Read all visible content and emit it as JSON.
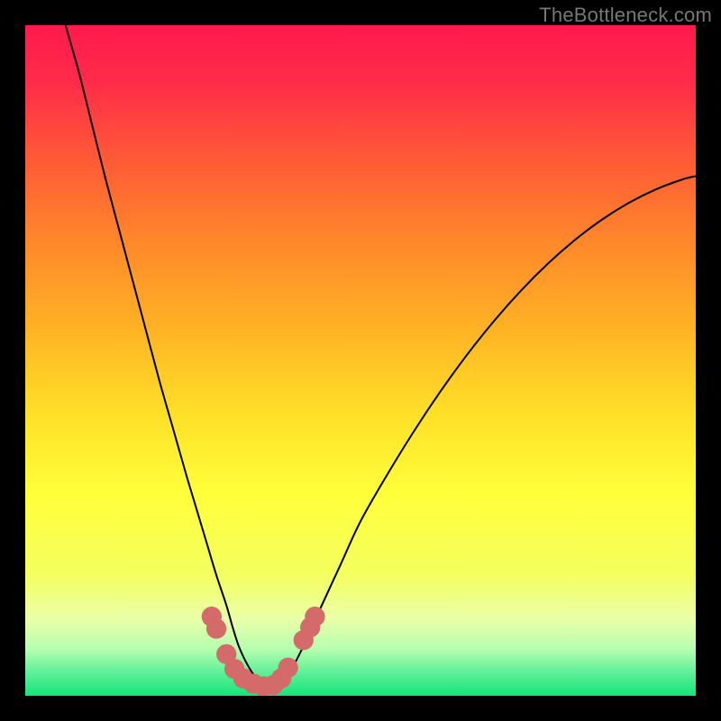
{
  "watermark": "TheBottleneck.com",
  "chart_data": {
    "type": "line",
    "title": "",
    "xlabel": "",
    "ylabel": "",
    "xlim": [
      0,
      100
    ],
    "ylim": [
      0,
      100
    ],
    "grid": false,
    "legend": false,
    "gradient_stops": [
      {
        "pos": 0.0,
        "color": "#ff1a4d"
      },
      {
        "pos": 0.08,
        "color": "#ff2a4a"
      },
      {
        "pos": 0.2,
        "color": "#ff5a36"
      },
      {
        "pos": 0.33,
        "color": "#ff8a2a"
      },
      {
        "pos": 0.46,
        "color": "#ffb524"
      },
      {
        "pos": 0.58,
        "color": "#ffe028"
      },
      {
        "pos": 0.7,
        "color": "#ffff3a"
      },
      {
        "pos": 0.82,
        "color": "#f4ff60"
      },
      {
        "pos": 0.885,
        "color": "#eaffa8"
      },
      {
        "pos": 0.93,
        "color": "#b6ffb0"
      },
      {
        "pos": 0.965,
        "color": "#60f09a"
      },
      {
        "pos": 1.0,
        "color": "#16e47a"
      }
    ],
    "series": [
      {
        "name": "curve",
        "color": "#000000",
        "width": 2,
        "x": [
          6.0,
          8.0,
          10.0,
          12.0,
          14.0,
          16.0,
          18.0,
          20.0,
          22.0,
          24.0,
          25.5,
          27.0,
          28.5,
          30.0,
          31.0,
          32.0,
          33.5,
          35.0,
          36.5,
          38.0,
          40.0,
          42.0,
          44.0,
          47.0,
          50.0,
          54.0,
          58.0,
          62.0,
          66.0,
          70.0,
          74.0,
          78.0,
          82.0,
          86.0,
          90.0,
          94.0,
          98.0,
          100.0
        ],
        "values": [
          100.0,
          93.0,
          85.0,
          77.0,
          69.5,
          62.0,
          54.5,
          47.0,
          40.0,
          33.0,
          28.0,
          23.0,
          18.0,
          13.5,
          10.0,
          7.0,
          4.0,
          2.0,
          1.2,
          1.8,
          4.5,
          8.5,
          13.0,
          19.5,
          26.0,
          33.0,
          39.5,
          45.5,
          51.0,
          56.0,
          60.5,
          64.5,
          68.0,
          71.0,
          73.5,
          75.5,
          77.0,
          77.5
        ]
      }
    ],
    "markers": {
      "color": "#d46a6a",
      "radius": 1.5,
      "points": [
        {
          "x": 27.8,
          "y": 11.8
        },
        {
          "x": 28.5,
          "y": 10.0
        },
        {
          "x": 30.0,
          "y": 6.2
        },
        {
          "x": 31.2,
          "y": 4.0
        },
        {
          "x": 32.5,
          "y": 2.6
        },
        {
          "x": 34.0,
          "y": 1.8
        },
        {
          "x": 35.5,
          "y": 1.4
        },
        {
          "x": 37.0,
          "y": 1.6
        },
        {
          "x": 38.2,
          "y": 2.6
        },
        {
          "x": 39.2,
          "y": 4.2
        },
        {
          "x": 41.5,
          "y": 8.3
        },
        {
          "x": 42.5,
          "y": 10.2
        },
        {
          "x": 43.2,
          "y": 11.8
        }
      ]
    }
  }
}
